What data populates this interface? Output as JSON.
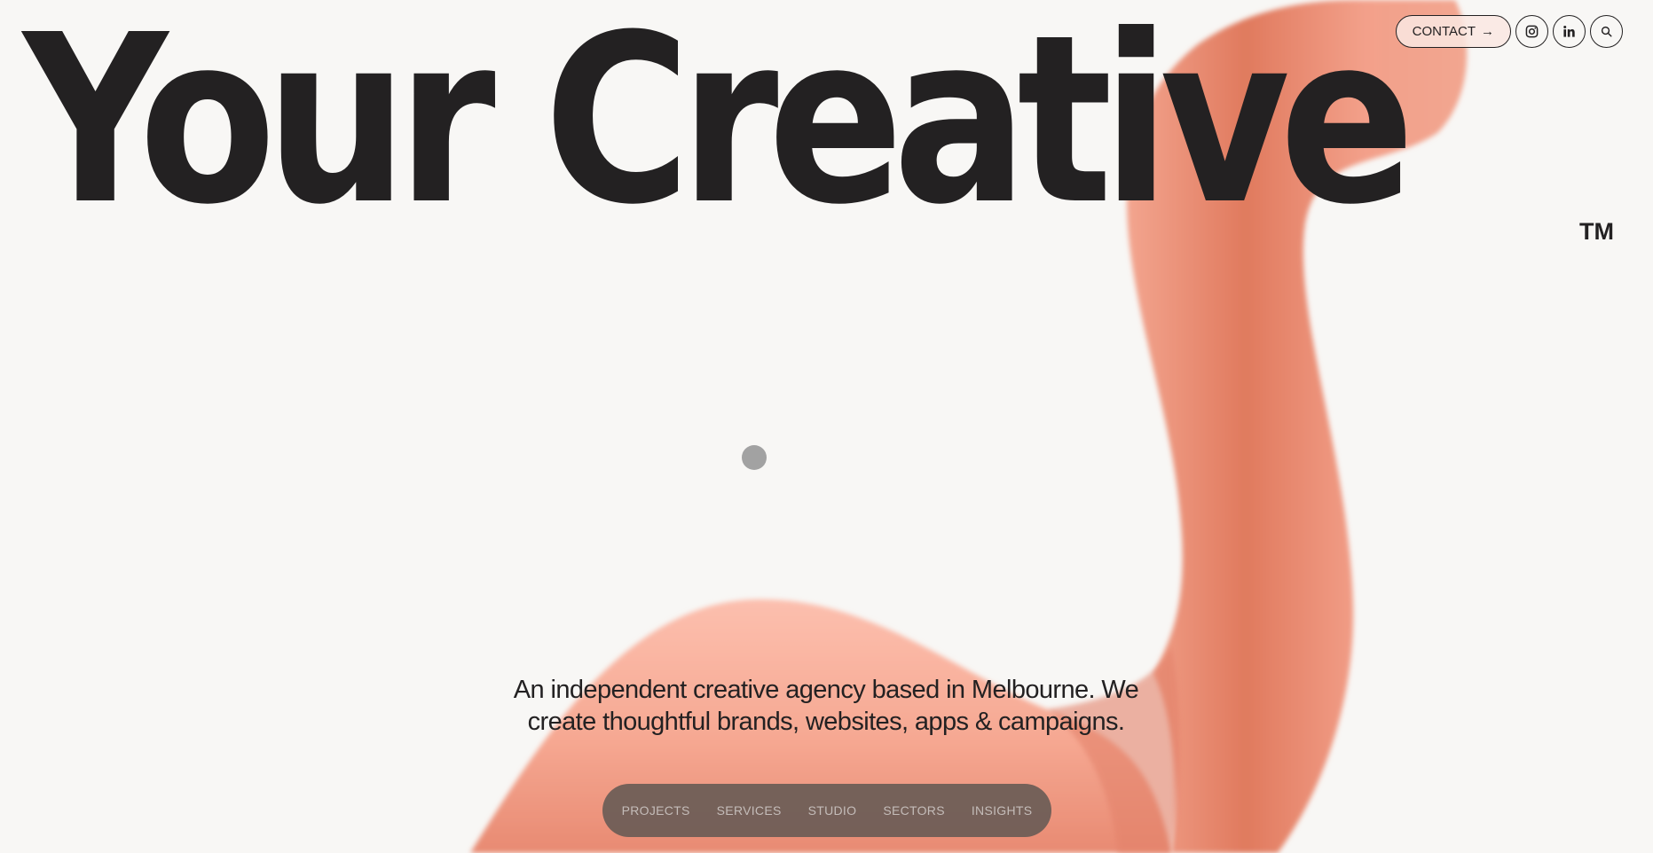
{
  "hero": {
    "title": "Your Creative",
    "trademark": "TM"
  },
  "header": {
    "contact_label": "CONTACT",
    "contact_arrow": "→",
    "social_icons": [
      "instagram-icon",
      "linkedin-icon",
      "search-icon"
    ]
  },
  "tagline": {
    "line1": "An independent creative agency based in Melbourne. We",
    "line2": "create thoughtful brands, websites, apps & campaigns."
  },
  "nav": {
    "items": [
      {
        "label": "PROJECTS"
      },
      {
        "label": "SERVICES"
      },
      {
        "label": "STUDIO"
      },
      {
        "label": "SECTORS"
      },
      {
        "label": "INSIGHTS"
      }
    ]
  },
  "colors": {
    "background": "#f8f7f5",
    "text": "#232122",
    "accent_blob": "#f0917a",
    "nav_pill": "#6c5c56",
    "nav_text": "#c4bcb9"
  }
}
